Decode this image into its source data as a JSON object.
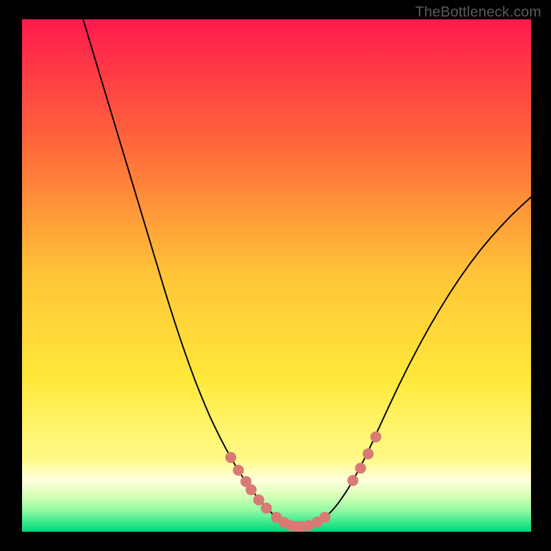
{
  "watermark": "TheBottleneck.com",
  "chart_data": {
    "type": "line",
    "title": "",
    "xlabel": "",
    "ylabel": "",
    "xlim": [
      0,
      100
    ],
    "ylim": [
      0,
      100
    ],
    "grid": false,
    "legend_position": "none",
    "gradient_stops": [
      {
        "offset": 0.0,
        "color": "#ff1a4d"
      },
      {
        "offset": 0.25,
        "color": "#ff6a3a"
      },
      {
        "offset": 0.5,
        "color": "#ffc538"
      },
      {
        "offset": 0.7,
        "color": "#ffe83a"
      },
      {
        "offset": 0.86,
        "color": "#fffb8a"
      },
      {
        "offset": 0.9,
        "color": "#ffffdf"
      },
      {
        "offset": 0.93,
        "color": "#d8ffb6"
      },
      {
        "offset": 0.96,
        "color": "#8cf9a2"
      },
      {
        "offset": 0.98,
        "color": "#40e98e"
      },
      {
        "offset": 1.0,
        "color": "#00d87a"
      }
    ],
    "series": [
      {
        "name": "bottleneck-curve",
        "color": "#000000",
        "stroke_width": 2,
        "x": [
          12,
          13,
          14,
          15,
          16,
          17,
          18,
          19,
          20,
          21,
          22,
          23,
          24,
          25,
          26,
          27,
          28,
          29,
          30,
          31,
          32,
          33,
          34,
          35,
          36,
          37,
          38,
          39,
          40,
          41,
          42,
          43,
          44,
          45,
          46,
          47,
          48,
          49,
          50,
          51,
          52,
          53,
          54,
          55,
          56,
          57,
          58,
          59,
          60,
          61,
          62,
          63,
          64,
          65,
          66,
          67,
          68,
          69,
          70,
          72,
          74,
          76,
          78,
          80,
          82,
          84,
          86,
          88,
          90,
          92,
          94,
          96,
          98,
          100
        ],
        "y": [
          100,
          96.7,
          93.4,
          90.1,
          86.8,
          83.5,
          80.2,
          76.9,
          73.6,
          70.3,
          67,
          63.7,
          60.4,
          57.1,
          53.8,
          50.5,
          47.2,
          44.0,
          40.9,
          37.9,
          35.0,
          32.2,
          29.5,
          27.0,
          24.6,
          22.3,
          20.2,
          18.2,
          16.3,
          14.5,
          12.8,
          11.2,
          9.7,
          8.3,
          7.0,
          5.8,
          4.7,
          3.7,
          2.8,
          2.1,
          1.6,
          1.2,
          1.0,
          1.0,
          1.1,
          1.4,
          1.8,
          2.4,
          3.2,
          4.2,
          5.4,
          6.8,
          8.3,
          10.0,
          11.8,
          13.7,
          15.7,
          17.8,
          20.0,
          24.3,
          28.5,
          32.5,
          36.3,
          39.9,
          43.3,
          46.5,
          49.5,
          52.3,
          54.9,
          57.3,
          59.5,
          61.6,
          63.5,
          65.3
        ]
      }
    ],
    "markers": {
      "name": "highlight-dots",
      "color": "#d97a74",
      "radius": 8,
      "points": [
        {
          "x": 41.0,
          "y": 14.5
        },
        {
          "x": 42.5,
          "y": 12.0
        },
        {
          "x": 44.0,
          "y": 9.8
        },
        {
          "x": 45.0,
          "y": 8.2
        },
        {
          "x": 46.5,
          "y": 6.2
        },
        {
          "x": 48.0,
          "y": 4.6
        },
        {
          "x": 50.0,
          "y": 2.8
        },
        {
          "x": 51.5,
          "y": 1.8
        },
        {
          "x": 52.8,
          "y": 1.2
        },
        {
          "x": 54.0,
          "y": 1.0
        },
        {
          "x": 55.0,
          "y": 1.0
        },
        {
          "x": 56.3,
          "y": 1.2
        },
        {
          "x": 58.0,
          "y": 1.9
        },
        {
          "x": 59.5,
          "y": 2.8
        },
        {
          "x": 65.0,
          "y": 10.0
        },
        {
          "x": 66.5,
          "y": 12.4
        },
        {
          "x": 68.0,
          "y": 15.2
        },
        {
          "x": 69.5,
          "y": 18.5
        }
      ]
    }
  }
}
